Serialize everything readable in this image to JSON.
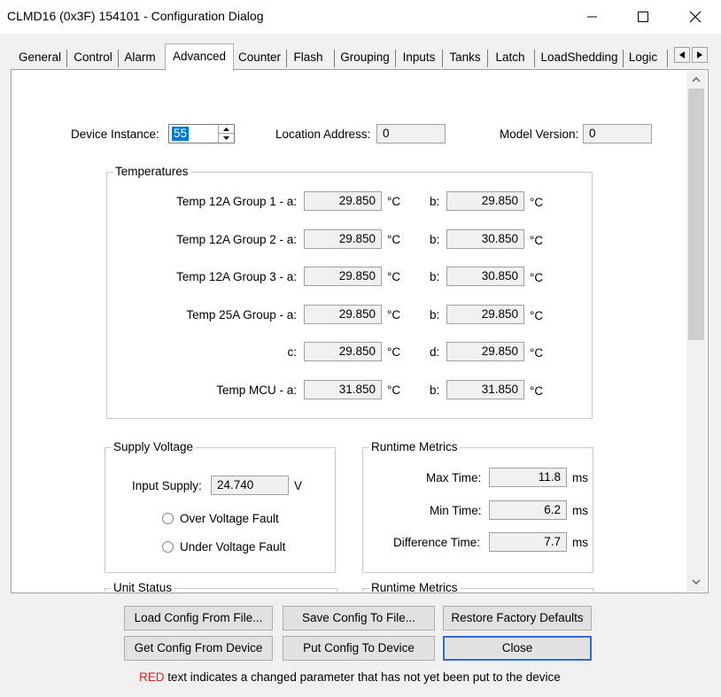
{
  "window": {
    "title": "CLMD16 (0x3F) 154101 - Configuration Dialog"
  },
  "tabs": [
    {
      "label": "General"
    },
    {
      "label": "Control"
    },
    {
      "label": "Alarm"
    },
    {
      "label": "Advanced",
      "active": true
    },
    {
      "label": "Counter"
    },
    {
      "label": "Flash"
    },
    {
      "label": "Grouping"
    },
    {
      "label": "Inputs"
    },
    {
      "label": "Tanks"
    },
    {
      "label": "Latch"
    },
    {
      "label": "LoadShedding"
    },
    {
      "label": "Logic"
    }
  ],
  "device": {
    "instance_label": "Device Instance:",
    "instance_value": "55",
    "location_label": "Location Address:",
    "location_value": "0",
    "model_label": "Model Version:",
    "model_value": "0"
  },
  "temperatures": {
    "title": "Temperatures",
    "rows": [
      {
        "label": "Temp 12A Group 1 - a:",
        "a": "29.850",
        "unit_a": "°C",
        "label_b": "b:",
        "b": "29.850",
        "unit_b": "°C"
      },
      {
        "label": "Temp 12A Group 2 - a:",
        "a": "29.850",
        "unit_a": "°C",
        "label_b": "b:",
        "b": "30.850",
        "unit_b": "°C"
      },
      {
        "label": "Temp 12A Group 3 - a:",
        "a": "29.850",
        "unit_a": "°C",
        "label_b": "b:",
        "b": "30.850",
        "unit_b": "°C"
      },
      {
        "label": "Temp 25A Group - a:",
        "a": "29.850",
        "unit_a": "°C",
        "label_b": "b:",
        "b": "29.850",
        "unit_b": "°C"
      },
      {
        "label": "c:",
        "a": "29.850",
        "unit_a": "°C",
        "label_b": "d:",
        "b": "29.850",
        "unit_b": "°C"
      },
      {
        "label": "Temp MCU - a:",
        "a": "31.850",
        "unit_a": "°C",
        "label_b": "b:",
        "b": "31.850",
        "unit_b": "°C"
      }
    ]
  },
  "supply": {
    "title": "Supply Voltage",
    "input_label": "Input Supply:",
    "input_value": "24.740",
    "input_unit": "V",
    "over_label": "Over Voltage Fault",
    "under_label": "Under Voltage Fault"
  },
  "runtime": {
    "title": "Runtime Metrics",
    "max_label": "Max Time:",
    "max_value": "11.8",
    "min_label": "Min Time:",
    "min_value": "6.2",
    "diff_label": "Difference Time:",
    "diff_value": "7.7",
    "unit": "ms"
  },
  "partial": {
    "unit_status_title": "Unit Status",
    "runtime2_title": "Runtime Metrics"
  },
  "buttons": {
    "load": "Load Config From File...",
    "save": "Save Config To File...",
    "restore": "Restore Factory Defaults",
    "get": "Get Config From Device",
    "put": "Put Config To Device",
    "close": "Close"
  },
  "footer": {
    "red_word": "RED",
    "note": " text indicates a changed parameter that has not yet been put to the device"
  },
  "colors": {
    "accent": "#2b6fd6",
    "changed": "#e02020",
    "selection": "#0078d7"
  }
}
